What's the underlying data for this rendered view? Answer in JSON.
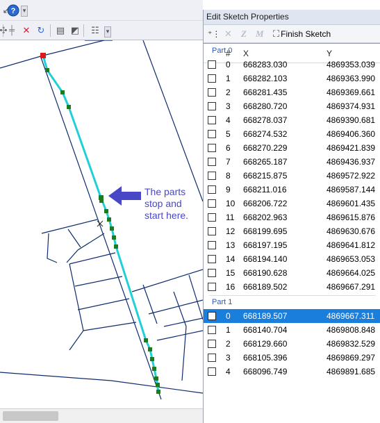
{
  "toolbar": {
    "row1_icons": [
      "arrow-icon",
      "help-icon",
      "overflow-icon"
    ],
    "row2_icons": [
      "move-icon",
      "delete-vertex-icon",
      "rotate-icon",
      "table-icon",
      "chart-icon",
      "edit-attributes-icon",
      "overflow-icon"
    ]
  },
  "map": {
    "annotation_lines": [
      "The parts",
      "stop and",
      "start here."
    ],
    "colors": {
      "roads": "#0d2b6e",
      "sketch": "#1fd0d8",
      "vertex": "#1f7a1f",
      "first_vertex": "#e01818",
      "annotation": "#4a47c7"
    }
  },
  "panel": {
    "title": "Edit Sketch Properties",
    "toolbar": {
      "insert_icon": "insert-vertex-icon",
      "delete_label": "✕",
      "z_label": "Z",
      "m_label": "M",
      "finish_label": "Finish Sketch"
    },
    "columns": {
      "index": "#",
      "x": "X",
      "y": "Y"
    },
    "parts": [
      {
        "label": "Part 0",
        "rows": [
          {
            "index": "0",
            "x": "668283.030",
            "y": "4869353.039"
          },
          {
            "index": "1",
            "x": "668282.103",
            "y": "4869363.990"
          },
          {
            "index": "2",
            "x": "668281.435",
            "y": "4869369.661"
          },
          {
            "index": "3",
            "x": "668280.720",
            "y": "4869374.931"
          },
          {
            "index": "4",
            "x": "668278.037",
            "y": "4869390.681"
          },
          {
            "index": "5",
            "x": "668274.532",
            "y": "4869406.360"
          },
          {
            "index": "6",
            "x": "668270.229",
            "y": "4869421.839"
          },
          {
            "index": "7",
            "x": "668265.187",
            "y": "4869436.937"
          },
          {
            "index": "8",
            "x": "668215.875",
            "y": "4869572.922"
          },
          {
            "index": "9",
            "x": "668211.016",
            "y": "4869587.144"
          },
          {
            "index": "10",
            "x": "668206.722",
            "y": "4869601.435"
          },
          {
            "index": "11",
            "x": "668202.963",
            "y": "4869615.876"
          },
          {
            "index": "12",
            "x": "668199.695",
            "y": "4869630.676"
          },
          {
            "index": "13",
            "x": "668197.195",
            "y": "4869641.812"
          },
          {
            "index": "14",
            "x": "668194.140",
            "y": "4869653.053"
          },
          {
            "index": "15",
            "x": "668190.628",
            "y": "4869664.025"
          },
          {
            "index": "16",
            "x": "668189.502",
            "y": "4869667.291"
          }
        ]
      },
      {
        "label": "Part 1",
        "rows": [
          {
            "index": "0",
            "x": "668189.507",
            "y": "4869667.311",
            "selected": true
          },
          {
            "index": "1",
            "x": "668140.704",
            "y": "4869808.848"
          },
          {
            "index": "2",
            "x": "668129.660",
            "y": "4869832.529"
          },
          {
            "index": "3",
            "x": "668105.396",
            "y": "4869869.297"
          },
          {
            "index": "4",
            "x": "668096.749",
            "y": "4869891.685"
          }
        ]
      }
    ]
  }
}
